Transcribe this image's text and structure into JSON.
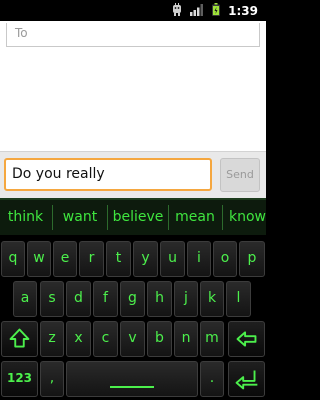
{
  "status_bar": {
    "time": "1:39",
    "icons": [
      "usb-debug-icon",
      "signal-icon",
      "battery-icon"
    ]
  },
  "compose": {
    "to_placeholder": "To"
  },
  "message": {
    "text": "Do you really",
    "send_label": "Send"
  },
  "suggestions": [
    "think",
    "want",
    "believe",
    "mean",
    "know"
  ],
  "keyboard": {
    "row1": [
      "q",
      "w",
      "e",
      "r",
      "t",
      "y",
      "u",
      "i",
      "o",
      "p"
    ],
    "row2": [
      "a",
      "s",
      "d",
      "f",
      "g",
      "h",
      "j",
      "k",
      "l"
    ],
    "row3": [
      "z",
      "x",
      "c",
      "v",
      "b",
      "n",
      "m"
    ],
    "symbols_label": "123",
    "comma_label": ",",
    "period_label": ".",
    "key_icons": [
      "shift-icon",
      "backspace-icon",
      "enter-icon"
    ]
  },
  "colors": {
    "key_text": "#4cf04c",
    "suggestion_text": "#3fe53f",
    "input_focus_border": "#f5a73f"
  }
}
